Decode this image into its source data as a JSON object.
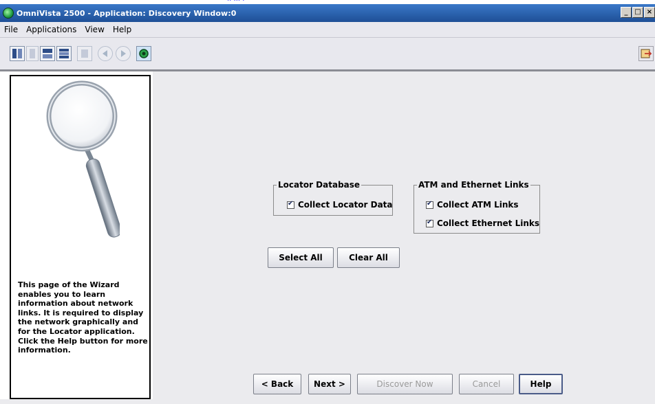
{
  "window": {
    "title": "OmniVista 2500 -  Application: Discovery   Window:0",
    "controls": [
      "_",
      "□",
      "×"
    ]
  },
  "menu": [
    {
      "label": "File",
      "mnemonic_index": 0
    },
    {
      "label": "Applications",
      "mnemonic_index": 5
    },
    {
      "label": "View",
      "mnemonic_index": 0
    },
    {
      "label": "Help",
      "mnemonic_index": 3
    }
  ],
  "toolbar": {
    "icons": [
      "vertical-split-icon",
      "single-pane-icon",
      "horizontal-split-icon",
      "stacked-panes-icon",
      "detach-pane-icon",
      "back-arrow-icon",
      "forward-arrow-icon",
      "home-globe-icon",
      "exit-icon"
    ]
  },
  "left_panel": {
    "image_icon": "magnifying-glass-icon",
    "help_text": "This page of the Wizard enables you to learn information about network links. It is required to display the network graphically and for the Locator application. Click the Help button for more information."
  },
  "groups": {
    "locator": {
      "legend": "Locator Database",
      "checkboxes": [
        {
          "label": "Collect Locator Data",
          "checked": true
        }
      ]
    },
    "links": {
      "legend": "ATM and Ethernet Links",
      "checkboxes": [
        {
          "label": "Collect ATM Links",
          "checked": true
        },
        {
          "label": "Collect Ethernet Links",
          "checked": true
        }
      ]
    }
  },
  "buttons": {
    "select_all": "Select All",
    "clear_all": "Clear All",
    "back": "< Back",
    "next": "Next >",
    "discover_now": "Discover Now",
    "cancel": "Cancel",
    "help": "Help"
  },
  "colors": {
    "title_bar": "#1e4f96",
    "panel_bg": "#ebebee",
    "left_panel_bg": "#ffffff"
  }
}
